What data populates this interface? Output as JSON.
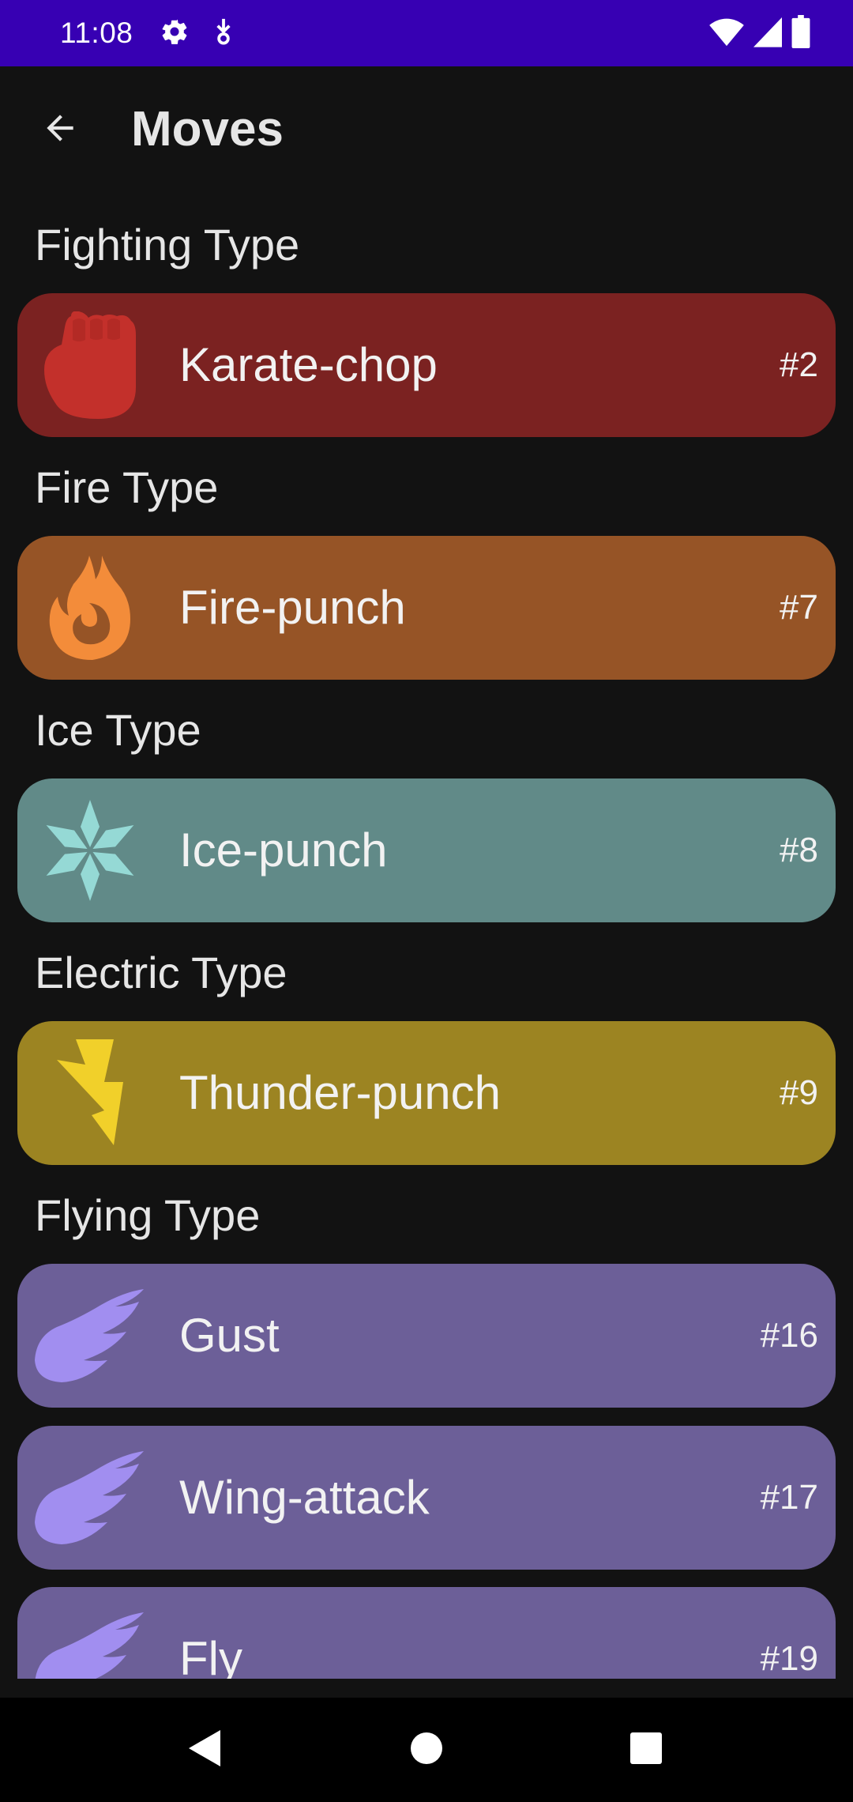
{
  "status_bar": {
    "time": "11:08",
    "left_icons": [
      "settings-gear-icon",
      "download-notification-icon"
    ],
    "right_icons": [
      "wifi-icon",
      "cellular-signal-icon",
      "battery-icon"
    ],
    "background": "#3700b3"
  },
  "app_bar": {
    "title": "Moves",
    "back_icon": "arrow-back-icon"
  },
  "sections": [
    {
      "header": "Fighting Type",
      "color": "#7b2221",
      "icon": "fist-icon",
      "moves": [
        {
          "name": "Karate-chop",
          "number": "#2"
        }
      ]
    },
    {
      "header": "Fire Type",
      "color": "#965426",
      "icon": "flame-icon",
      "moves": [
        {
          "name": "Fire-punch",
          "number": "#7"
        }
      ]
    },
    {
      "header": "Ice Type",
      "color": "#618a88",
      "icon": "snowflake-icon",
      "moves": [
        {
          "name": "Ice-punch",
          "number": "#8"
        }
      ]
    },
    {
      "header": "Electric Type",
      "color": "#9c8422",
      "icon": "lightning-bolt-icon",
      "moves": [
        {
          "name": "Thunder-punch",
          "number": "#9"
        }
      ]
    },
    {
      "header": "Flying Type",
      "color": "#6c5f98",
      "icon": "wing-icon",
      "moves": [
        {
          "name": "Gust",
          "number": "#16"
        },
        {
          "name": "Wing-attack",
          "number": "#17"
        },
        {
          "name": "Fly",
          "number": "#19"
        }
      ]
    }
  ],
  "nav_bar": {
    "buttons": [
      "nav-back-icon",
      "nav-home-icon",
      "nav-recents-icon"
    ]
  }
}
